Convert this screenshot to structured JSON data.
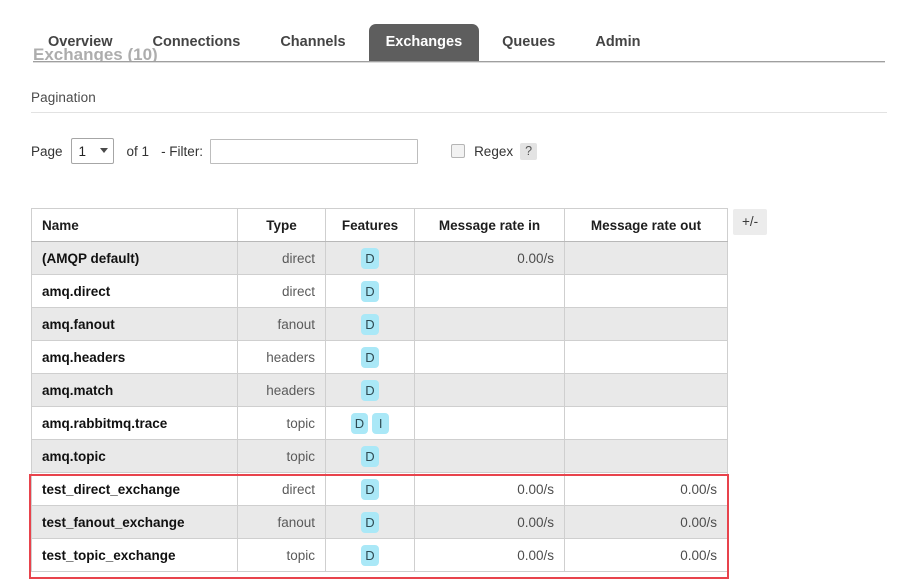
{
  "nav": {
    "tabs": [
      {
        "label": "Overview",
        "active": false
      },
      {
        "label": "Connections",
        "active": false
      },
      {
        "label": "Channels",
        "active": false
      },
      {
        "label": "Exchanges",
        "active": true
      },
      {
        "label": "Queues",
        "active": false
      },
      {
        "label": "Admin",
        "active": false
      }
    ],
    "active_tab": "Exchanges",
    "clipped_heading": "Exchanges (10)"
  },
  "pagination": {
    "title": "Pagination",
    "page_label": "Page",
    "page_value": "1",
    "page_options": [
      "1"
    ],
    "of_total": "of 1",
    "filter_label": "- Filter:",
    "filter_value": "",
    "filter_placeholder": "",
    "regex_label": "Regex",
    "regex_checked": false,
    "help_label": "?"
  },
  "table": {
    "columns": [
      "Name",
      "Type",
      "Features",
      "Message rate in",
      "Message rate out"
    ],
    "toggle_label": "+/-",
    "rows": [
      {
        "name": "(AMQP default)",
        "type": "direct",
        "features": [
          "D"
        ],
        "rate_in": "0.00/s",
        "rate_out": "",
        "highlighted": false
      },
      {
        "name": "amq.direct",
        "type": "direct",
        "features": [
          "D"
        ],
        "rate_in": "",
        "rate_out": "",
        "highlighted": false
      },
      {
        "name": "amq.fanout",
        "type": "fanout",
        "features": [
          "D"
        ],
        "rate_in": "",
        "rate_out": "",
        "highlighted": false
      },
      {
        "name": "amq.headers",
        "type": "headers",
        "features": [
          "D"
        ],
        "rate_in": "",
        "rate_out": "",
        "highlighted": false
      },
      {
        "name": "amq.match",
        "type": "headers",
        "features": [
          "D"
        ],
        "rate_in": "",
        "rate_out": "",
        "highlighted": false
      },
      {
        "name": "amq.rabbitmq.trace",
        "type": "topic",
        "features": [
          "D",
          "I"
        ],
        "rate_in": "",
        "rate_out": "",
        "highlighted": false
      },
      {
        "name": "amq.topic",
        "type": "topic",
        "features": [
          "D"
        ],
        "rate_in": "",
        "rate_out": "",
        "highlighted": false
      },
      {
        "name": "test_direct_exchange",
        "type": "direct",
        "features": [
          "D"
        ],
        "rate_in": "0.00/s",
        "rate_out": "0.00/s",
        "highlighted": true
      },
      {
        "name": "test_fanout_exchange",
        "type": "fanout",
        "features": [
          "D"
        ],
        "rate_in": "0.00/s",
        "rate_out": "0.00/s",
        "highlighted": true
      },
      {
        "name": "test_topic_exchange",
        "type": "topic",
        "features": [
          "D"
        ],
        "rate_in": "0.00/s",
        "rate_out": "0.00/s",
        "highlighted": true
      }
    ]
  },
  "colors": {
    "active_tab_bg": "#5e5e5e",
    "badge_bg": "#aae8f7",
    "row_stripe": "#e9e9e9",
    "annotation_red": "#e8434c",
    "border": "#cfcfcf"
  }
}
